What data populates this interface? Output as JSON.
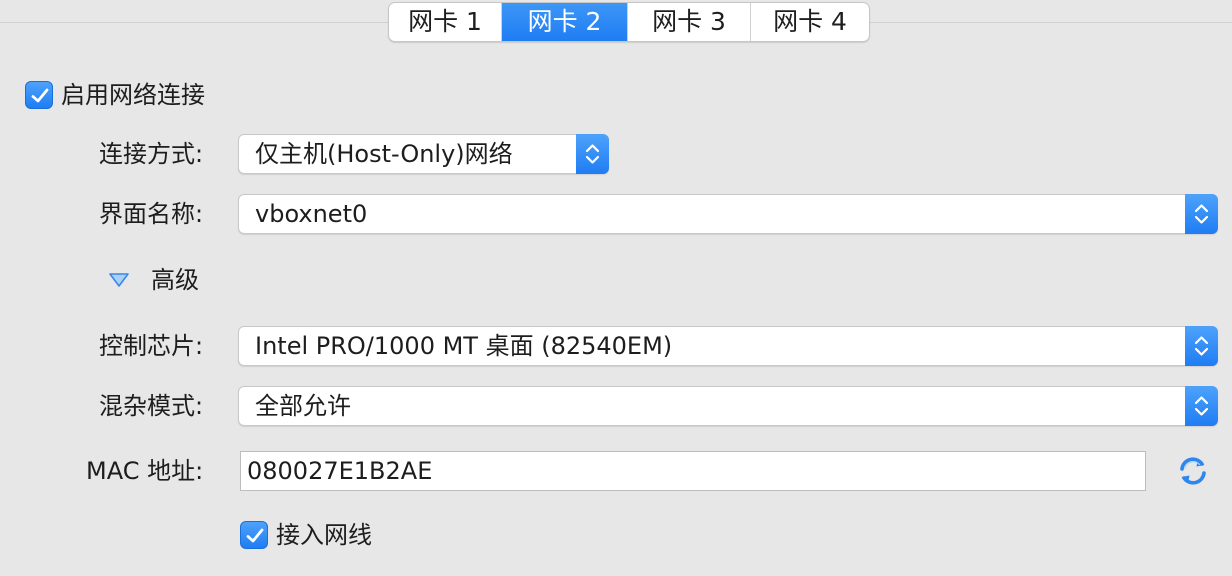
{
  "tabs": [
    {
      "label": "网卡 1",
      "active": false
    },
    {
      "label": "网卡 2",
      "active": true
    },
    {
      "label": "网卡 3",
      "active": false
    },
    {
      "label": "网卡 4",
      "active": false
    }
  ],
  "enable_network": {
    "label": "启用网络连接",
    "checked": true
  },
  "attachment": {
    "label": "连接方式:",
    "value": "仅主机(Host-Only)网络"
  },
  "interface": {
    "label": "界面名称:",
    "value": "vboxnet0"
  },
  "advanced": {
    "label": "高级",
    "expanded": true
  },
  "adapter_type": {
    "label": "控制芯片:",
    "value": "Intel PRO/1000 MT 桌面 (82540EM)"
  },
  "promiscuous": {
    "label": "混杂模式:",
    "value": "全部允许"
  },
  "mac": {
    "label": "MAC 地址:",
    "value": "080027E1B2AE",
    "refresh_icon": "refresh-icon"
  },
  "cable": {
    "label": "接入网线",
    "checked": true
  },
  "colors": {
    "accent": "#1f7df3",
    "background": "#e7e7e7"
  }
}
